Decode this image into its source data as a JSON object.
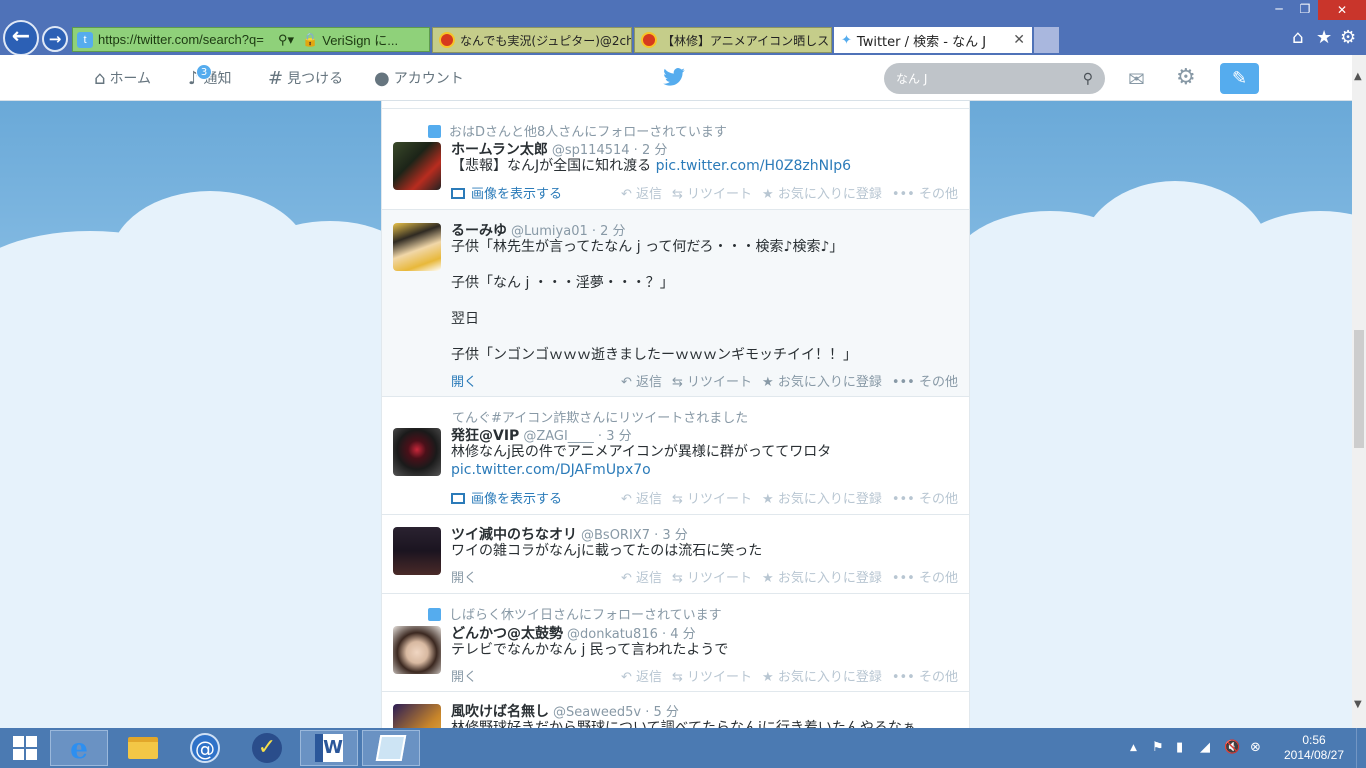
{
  "browser": {
    "address_url": "https://twitter.com/search?q=",
    "cert_label": "VeriSign に...",
    "tabs": [
      {
        "title": "なんでも実況(ジュピター)@2ch..."
      },
      {
        "title": "【林修】アニメアイコン晒しスレ【アフ..."
      },
      {
        "title": "Twitter / 検索 - なん J"
      }
    ]
  },
  "twitter_nav": {
    "home": "ホーム",
    "notifications": "通知",
    "notification_count": "3",
    "discover": "見つける",
    "account": "アカウント",
    "search_value": "なん J"
  },
  "tweets": [
    {
      "context": "おはDさんと他8人さんにフォローされています",
      "name": "ホームラン太郎",
      "screen_name": "@sp114514 · 2 分",
      "text_lines": [
        "【悲報】なんJが全国に知れ渡る "
      ],
      "link": "pic.twitter.com/H0Z8zhNIp6",
      "left_action": "画像を表示する"
    },
    {
      "name": "るーみゆ",
      "screen_name": "@Lumiya01 · 2 分",
      "text_lines": [
        "子供「林先生が言ってたなん j って何だろ・・・検索♪検索♪」",
        "子供「なん j ・・・淫夢・・・？」",
        "翌日",
        "子供「ンゴンゴｗｗｗ逝きましたーｗｗｗンギモッチイイ！！」"
      ],
      "left_action": "開く"
    },
    {
      "context": "てんぐ#アイコン詐欺さんにリツイートされました",
      "name": "発狂@VIP",
      "screen_name": "@ZAGI____ · 3 分",
      "text_lines": [
        "林修なんj民の件でアニメアイコンが異様に群がっててワロタ"
      ],
      "link": "pic.twitter.com/DJAFmUpx7o",
      "left_action": "画像を表示する"
    },
    {
      "name": "ツイ減中のちなオリ",
      "screen_name": "@BsORIX7 · 3 分",
      "text_lines": [
        "ワイの雑コラがなんjに載ってたのは流石に笑った"
      ],
      "left_action": "開く"
    },
    {
      "context": "しばらく休ツイ日さんにフォローされています",
      "name": "どんかつ@太鼓勢",
      "screen_name": "@donkatu816 · 4 分",
      "text_lines": [
        "テレビでなんかなん j 民って言われたようで"
      ],
      "left_action": "開く"
    },
    {
      "name": "風吹けば名無し",
      "screen_name": "@Seaweed5v · 5 分",
      "text_lines": [
        "林修野球好きだから野球について調べてたらなんjに行き着いたんやろなぁ"
      ]
    }
  ],
  "actions": {
    "reply": "返信",
    "retweet": "リツイート",
    "favorite": "お気に入りに登録",
    "more": "その他"
  },
  "taskbar": {
    "time": "0:56",
    "date": "2014/08/27"
  },
  "colors": {
    "twitter_blue": "#55acee",
    "link_blue": "#2b7bb9",
    "address_bar_green": "#8fd17a",
    "taskbar_blue": "#4b7ab2",
    "close_red": "#c9352b"
  }
}
